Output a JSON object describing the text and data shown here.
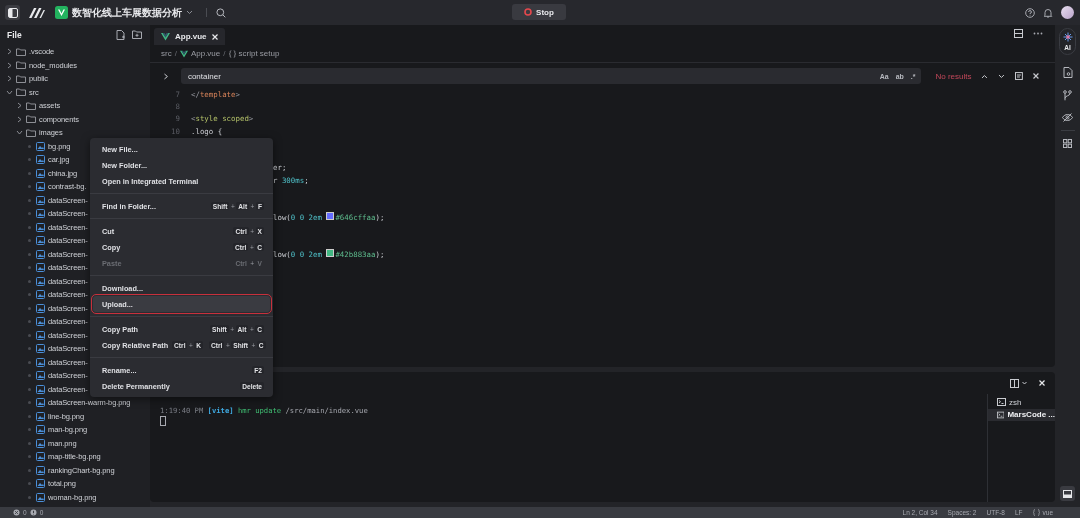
{
  "top_bar": {
    "project": "数智化线上车展数据分析",
    "run_button": "Stop"
  },
  "sidebar": {
    "title": "File",
    "tree": [
      {
        "label": ".vscode",
        "kind": "folder",
        "expanded": false
      },
      {
        "label": "node_modules",
        "kind": "folder",
        "expanded": false
      },
      {
        "label": "public",
        "kind": "folder",
        "expanded": false
      },
      {
        "label": "src",
        "kind": "folder",
        "expanded": true,
        "children": [
          {
            "label": "assets",
            "kind": "folder",
            "expanded": false
          },
          {
            "label": "components",
            "kind": "folder",
            "expanded": false
          },
          {
            "label": "images",
            "kind": "folder",
            "expanded": true,
            "children": [
              {
                "label": "bg.png",
                "kind": "image"
              },
              {
                "label": "car.jpg",
                "kind": "image"
              },
              {
                "label": "china.jpg",
                "kind": "image"
              },
              {
                "label": "contrast-bg.",
                "kind": "image"
              },
              {
                "label": "dataScreen-",
                "kind": "image"
              },
              {
                "label": "dataScreen-",
                "kind": "image"
              },
              {
                "label": "dataScreen-",
                "kind": "image"
              },
              {
                "label": "dataScreen-",
                "kind": "image"
              },
              {
                "label": "dataScreen-",
                "kind": "image"
              },
              {
                "label": "dataScreen-",
                "kind": "image"
              },
              {
                "label": "dataScreen-",
                "kind": "image"
              },
              {
                "label": "dataScreen-",
                "kind": "image"
              },
              {
                "label": "dataScreen-",
                "kind": "image"
              },
              {
                "label": "dataScreen-",
                "kind": "image"
              },
              {
                "label": "dataScreen-",
                "kind": "image"
              },
              {
                "label": "dataScreen-",
                "kind": "image"
              },
              {
                "label": "dataScreen-",
                "kind": "image"
              },
              {
                "label": "dataScreen-",
                "kind": "image"
              },
              {
                "label": "dataScreen-",
                "kind": "image"
              },
              {
                "label": "dataScreen-warm-bg.png",
                "kind": "image"
              },
              {
                "label": "line-bg.png",
                "kind": "image"
              },
              {
                "label": "man-bg.png",
                "kind": "image"
              },
              {
                "label": "man.png",
                "kind": "image"
              },
              {
                "label": "map-title-bg.png",
                "kind": "image"
              },
              {
                "label": "rankingChart-bg.png",
                "kind": "image"
              },
              {
                "label": "total.png",
                "kind": "image"
              },
              {
                "label": "woman-bg.png",
                "kind": "image"
              }
            ]
          }
        ]
      }
    ]
  },
  "editor": {
    "tabs": [
      {
        "label": "App.vue",
        "selected": true
      }
    ],
    "breadcrumb": [
      {
        "label": "src",
        "kind": "folder"
      },
      {
        "label": "App.vue",
        "kind": "vue",
        "separator": "/"
      },
      {
        "label": "script setup",
        "kind": "symbol",
        "separator": "/"
      }
    ],
    "find": {
      "value": "container",
      "options": [
        "Aa",
        "ab",
        ".*"
      ],
      "status": "No results"
    },
    "code": [
      {
        "kind": "full",
        "n": "7",
        "tokens": [
          {
            "text": "</",
            "kind": "punct"
          },
          {
            "text": "template",
            "kind": "tag"
          },
          {
            "text": ">",
            "kind": "punct"
          }
        ]
      },
      {
        "kind": "full",
        "n": "8"
      },
      {
        "kind": "full",
        "n": "9",
        "tokens": [
          {
            "text": "<",
            "kind": "punct"
          },
          {
            "text": "style scoped",
            "kind": "keyword"
          },
          {
            "text": ">",
            "kind": "punct"
          }
        ]
      },
      {
        "kind": "full",
        "n": "10",
        "tokens": [
          {
            "text": ".logo {",
            "kind": "plain"
          }
        ]
      },
      {
        "kind": "hidden"
      },
      {
        "kind": "hidden"
      },
      {
        "kind": "covered",
        "tokens": [
          {
            "text": "er;",
            "kind": "plain"
          }
        ]
      },
      {
        "kind": "covered",
        "tokens": [
          {
            "text": "r",
            "kind": "plain"
          },
          {
            "text": " 300ms",
            "kind": "number"
          },
          {
            "text": ";",
            "kind": "plain"
          }
        ]
      },
      {
        "kind": "hidden"
      },
      {
        "kind": "hidden"
      },
      {
        "kind": "covered",
        "tokens": [
          {
            "text": "low(",
            "kind": "plain"
          },
          {
            "text": "0 0 2em ",
            "kind": "number"
          },
          {
            "kind": "swatch",
            "color": "#646cff"
          },
          {
            "text": "#646cffaa",
            "kind": "string"
          },
          {
            "text": ");",
            "kind": "plain"
          }
        ]
      },
      {
        "kind": "hidden"
      },
      {
        "kind": "hidden"
      },
      {
        "kind": "covered",
        "tokens": [
          {
            "text": "low(",
            "kind": "plain"
          },
          {
            "text": "0 0 2em ",
            "kind": "number"
          },
          {
            "kind": "swatch",
            "color": "#42b883"
          },
          {
            "text": "#42b883aa",
            "kind": "string"
          },
          {
            "text": ");",
            "kind": "plain"
          }
        ]
      }
    ]
  },
  "context_menu": {
    "groups": [
      [
        {
          "label": "New File...",
          "disabled": false,
          "selected": false
        },
        {
          "label": "New Folder...",
          "disabled": false,
          "selected": false
        },
        {
          "label": "Open in Integrated Terminal",
          "disabled": false,
          "selected": false
        }
      ],
      [
        {
          "label": "Find in Folder...",
          "disabled": false,
          "selected": false,
          "shortcut": [
            {
              "kind": "key",
              "text": "Shift"
            },
            {
              "kind": "plus",
              "text": "+"
            },
            {
              "kind": "key",
              "text": "Alt"
            },
            {
              "kind": "plus",
              "text": "+"
            },
            {
              "kind": "key",
              "text": "F"
            }
          ]
        }
      ],
      [
        {
          "label": "Cut",
          "disabled": false,
          "selected": false,
          "shortcut": [
            {
              "kind": "key",
              "text": "Ctrl"
            },
            {
              "kind": "plus",
              "text": "+"
            },
            {
              "kind": "key",
              "text": "X"
            }
          ]
        },
        {
          "label": "Copy",
          "disabled": false,
          "selected": false,
          "shortcut": [
            {
              "kind": "key",
              "text": "Ctrl"
            },
            {
              "kind": "plus",
              "text": "+"
            },
            {
              "kind": "key",
              "text": "C"
            }
          ]
        },
        {
          "label": "Paste",
          "disabled": true,
          "selected": false,
          "shortcut": [
            {
              "kind": "key",
              "text": "Ctrl"
            },
            {
              "kind": "plus",
              "text": "+"
            },
            {
              "kind": "key",
              "text": "V"
            }
          ]
        }
      ],
      [
        {
          "label": "Download...",
          "disabled": false,
          "selected": false
        },
        {
          "label": "Upload...",
          "disabled": false,
          "selected": true
        }
      ],
      [
        {
          "label": "Copy Path",
          "disabled": false,
          "selected": false,
          "shortcut": [
            {
              "kind": "key",
              "text": "Shift"
            },
            {
              "kind": "plus",
              "text": "+"
            },
            {
              "kind": "key",
              "text": "Alt"
            },
            {
              "kind": "plus",
              "text": "+"
            },
            {
              "kind": "key",
              "text": "C"
            }
          ]
        },
        {
          "label": "Copy Relative Path",
          "disabled": false,
          "selected": false,
          "shortcut": [
            {
              "kind": "key",
              "text": "Ctrl"
            },
            {
              "kind": "plus",
              "text": "+"
            },
            {
              "kind": "key",
              "text": "K"
            },
            {
              "kind": "gap"
            },
            {
              "kind": "key",
              "text": "Ctrl"
            },
            {
              "kind": "plus",
              "text": "+"
            },
            {
              "kind": "key",
              "text": "Shift"
            },
            {
              "kind": "plus",
              "text": "+"
            },
            {
              "kind": "key",
              "text": "C"
            }
          ]
        }
      ],
      [
        {
          "label": "Rename...",
          "disabled": false,
          "selected": false,
          "shortcut": [
            {
              "kind": "key",
              "text": "F2"
            }
          ]
        },
        {
          "label": "Delete Permanently",
          "disabled": false,
          "selected": false,
          "shortcut": [
            {
              "kind": "key",
              "text": "Delete"
            }
          ]
        }
      ]
    ]
  },
  "terminal": {
    "lines": [
      [
        {
          "text": "1:19:40 PM",
          "kind": "time"
        },
        {
          "text": "[vite]",
          "kind": "tag"
        },
        {
          "text": "hmr update",
          "kind": "action"
        },
        {
          "text": "/src/main/index.vue",
          "kind": "path"
        }
      ]
    ],
    "sessions": [
      {
        "label": "zsh",
        "selected": false
      },
      {
        "label": "MarsCode ...",
        "selected": true
      }
    ]
  },
  "activity_bar": {
    "ai_label": "AI"
  },
  "status_bar": {
    "errors": "0",
    "warnings": "0",
    "items": [
      "Ln 2, Col 34",
      "Spaces: 2",
      "UTF-8",
      "LF"
    ],
    "language": "vue"
  }
}
